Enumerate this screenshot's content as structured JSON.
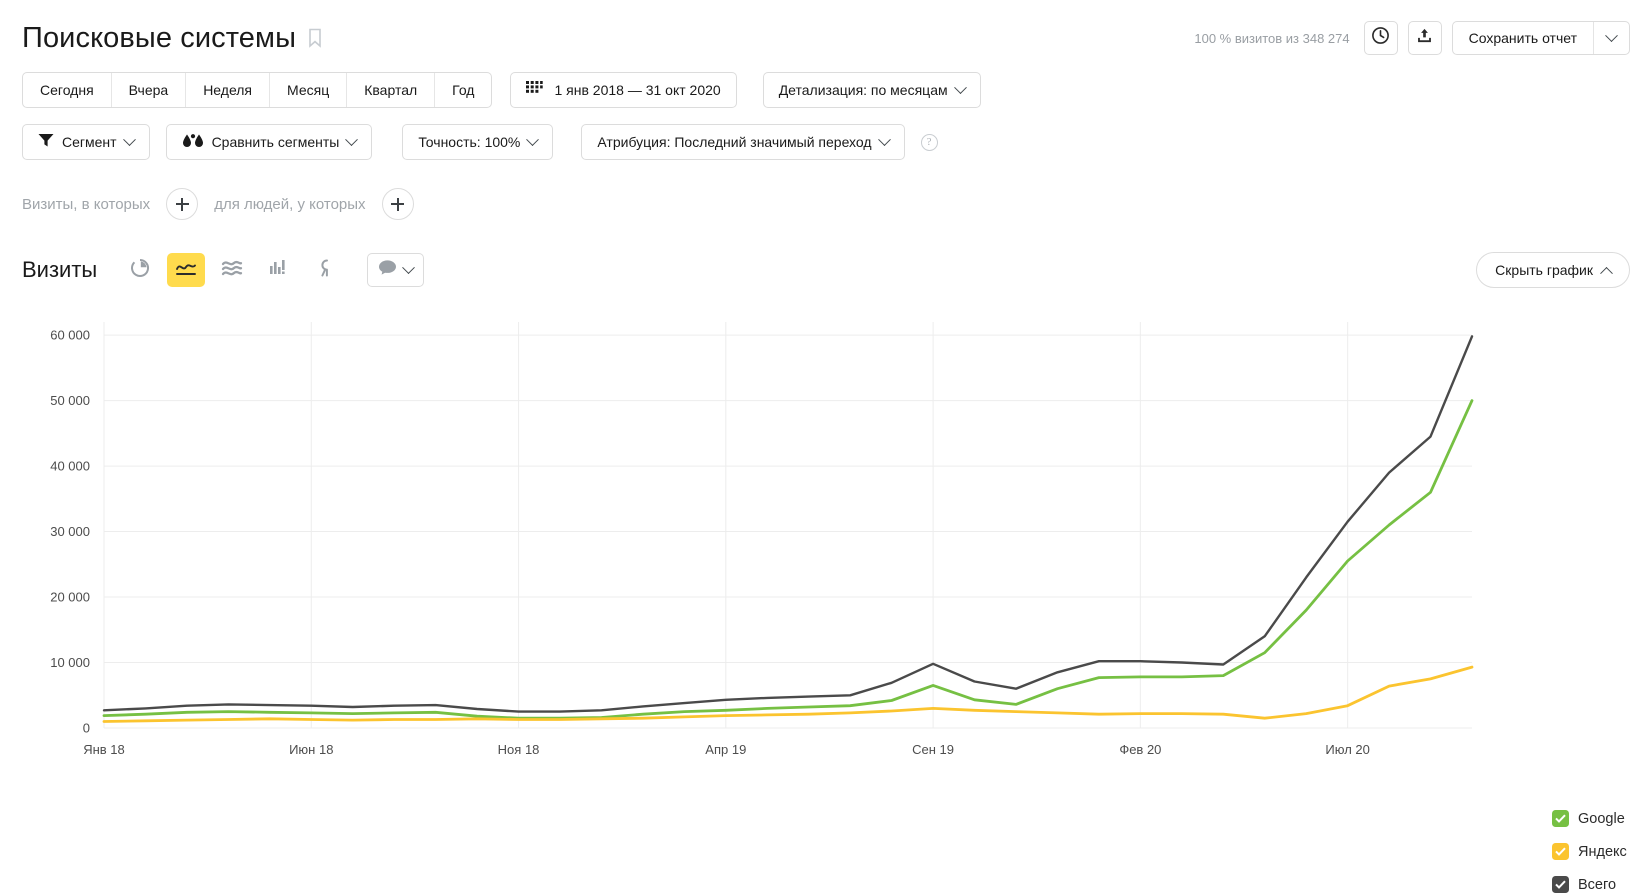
{
  "header": {
    "title": "Поисковые системы",
    "bookmark_icon": "bookmark-icon",
    "visits_info": "100 % визитов из 348 274",
    "history_icon": "clock-icon",
    "export_icon": "export-icon",
    "save_label": "Сохранить отчет",
    "save_caret_icon": "chevron-down-icon"
  },
  "periods": [
    {
      "label": "Сегодня"
    },
    {
      "label": "Вчера"
    },
    {
      "label": "Неделя"
    },
    {
      "label": "Месяц"
    },
    {
      "label": "Квартал"
    },
    {
      "label": "Год"
    }
  ],
  "date_range": {
    "icon": "calendar-icon",
    "label": "1 янв 2018 — 31 окт 2020"
  },
  "detail": {
    "label": "Детализация: по месяцам",
    "caret_icon": "chevron-down-icon"
  },
  "filters": {
    "segment": {
      "icon": "funnel-icon",
      "label": "Сегмент",
      "caret_icon": "chevron-down-icon"
    },
    "compare": {
      "icon": "compare-drops-icon",
      "label": "Сравнить сегменты",
      "caret_icon": "chevron-down-icon"
    },
    "accuracy": {
      "label": "Точность: 100%",
      "caret_icon": "chevron-down-icon"
    },
    "attribution": {
      "label": "Атрибуция: Последний значимый переход",
      "caret_icon": "chevron-down-icon"
    },
    "help": "?"
  },
  "conditions": {
    "visits_label": "Визиты, в которых",
    "visits_add_icon": "plus-icon",
    "people_label": "для людей, у которых",
    "people_add_icon": "plus-icon"
  },
  "metric_bar": {
    "title": "Визиты",
    "viz": [
      {
        "name": "pie-chart-icon",
        "active": false
      },
      {
        "name": "line-chart-icon",
        "active": true
      },
      {
        "name": "area-chart-icon",
        "active": false
      },
      {
        "name": "bar-chart-icon",
        "active": false
      },
      {
        "name": "map-chart-icon",
        "active": false
      }
    ],
    "comment": {
      "icon": "comment-icon",
      "caret_icon": "chevron-down-icon"
    },
    "hide_chart_label": "Скрыть график",
    "hide_chart_caret_icon": "chevron-up-icon"
  },
  "colors": {
    "google": "#76c043",
    "yandex": "#fbc42f",
    "total": "#4a4a4a",
    "grid": "#ededed",
    "accent": "#ffdb4d"
  },
  "chart_data": {
    "type": "line",
    "title": "Визиты",
    "xlabel": "",
    "ylabel": "",
    "ylim": [
      0,
      62000
    ],
    "yticks": [
      0,
      10000,
      20000,
      30000,
      40000,
      50000,
      60000
    ],
    "ytick_labels": [
      "0",
      "10 000",
      "20 000",
      "30 000",
      "40 000",
      "50 000",
      "60 000"
    ],
    "grid": true,
    "legend_position": "right",
    "x": [
      "Янв 18",
      "Фев 18",
      "Мар 18",
      "Апр 18",
      "Май 18",
      "Июн 18",
      "Июл 18",
      "Авг 18",
      "Сен 18",
      "Окт 18",
      "Ноя 18",
      "Дек 18",
      "Янв 19",
      "Фев 19",
      "Мар 19",
      "Апр 19",
      "Май 19",
      "Июн 19",
      "Июл 19",
      "Авг 19",
      "Сен 19",
      "Окт 19",
      "Ноя 19",
      "Дек 19",
      "Янв 20",
      "Фев 20",
      "Мар 20",
      "Апр 20",
      "Май 20",
      "Июн 20",
      "Июл 20",
      "Авг 20",
      "Сен 20",
      "Окт 20"
    ],
    "xtick_labels": [
      "Янв 18",
      "Июн 18",
      "Ноя 18",
      "Апр 19",
      "Сен 19",
      "Фев 20",
      "Июл 20"
    ],
    "xtick_indices": [
      0,
      5,
      10,
      15,
      20,
      25,
      30
    ],
    "series": [
      {
        "name": "Google",
        "color": "#76c043",
        "checked": true,
        "values": [
          1900,
          2100,
          2400,
          2500,
          2400,
          2300,
          2200,
          2300,
          2400,
          1800,
          1500,
          1500,
          1600,
          2100,
          2500,
          2700,
          3000,
          3200,
          3400,
          4200,
          6500,
          4300,
          3600,
          6000,
          7700,
          7800,
          7800,
          8000,
          11500,
          18000,
          25500,
          31000,
          36000,
          50000
        ]
      },
      {
        "name": "Яндекс",
        "color": "#fbc42f",
        "checked": true,
        "values": [
          1000,
          1100,
          1200,
          1300,
          1400,
          1300,
          1200,
          1300,
          1300,
          1400,
          1300,
          1300,
          1400,
          1500,
          1700,
          1900,
          2000,
          2100,
          2300,
          2600,
          3000,
          2700,
          2500,
          2300,
          2100,
          2200,
          2200,
          2100,
          1500,
          2200,
          3400,
          6400,
          7500,
          9300
        ]
      },
      {
        "name": "Всего",
        "color": "#4a4a4a",
        "checked": true,
        "values": [
          2700,
          3000,
          3400,
          3600,
          3500,
          3400,
          3200,
          3400,
          3500,
          2900,
          2500,
          2500,
          2700,
          3300,
          3800,
          4300,
          4600,
          4800,
          5000,
          6900,
          9800,
          7100,
          6000,
          8500,
          10200,
          10200,
          10000,
          9700,
          14000,
          23000,
          31500,
          39000,
          44500,
          59800
        ]
      }
    ]
  }
}
